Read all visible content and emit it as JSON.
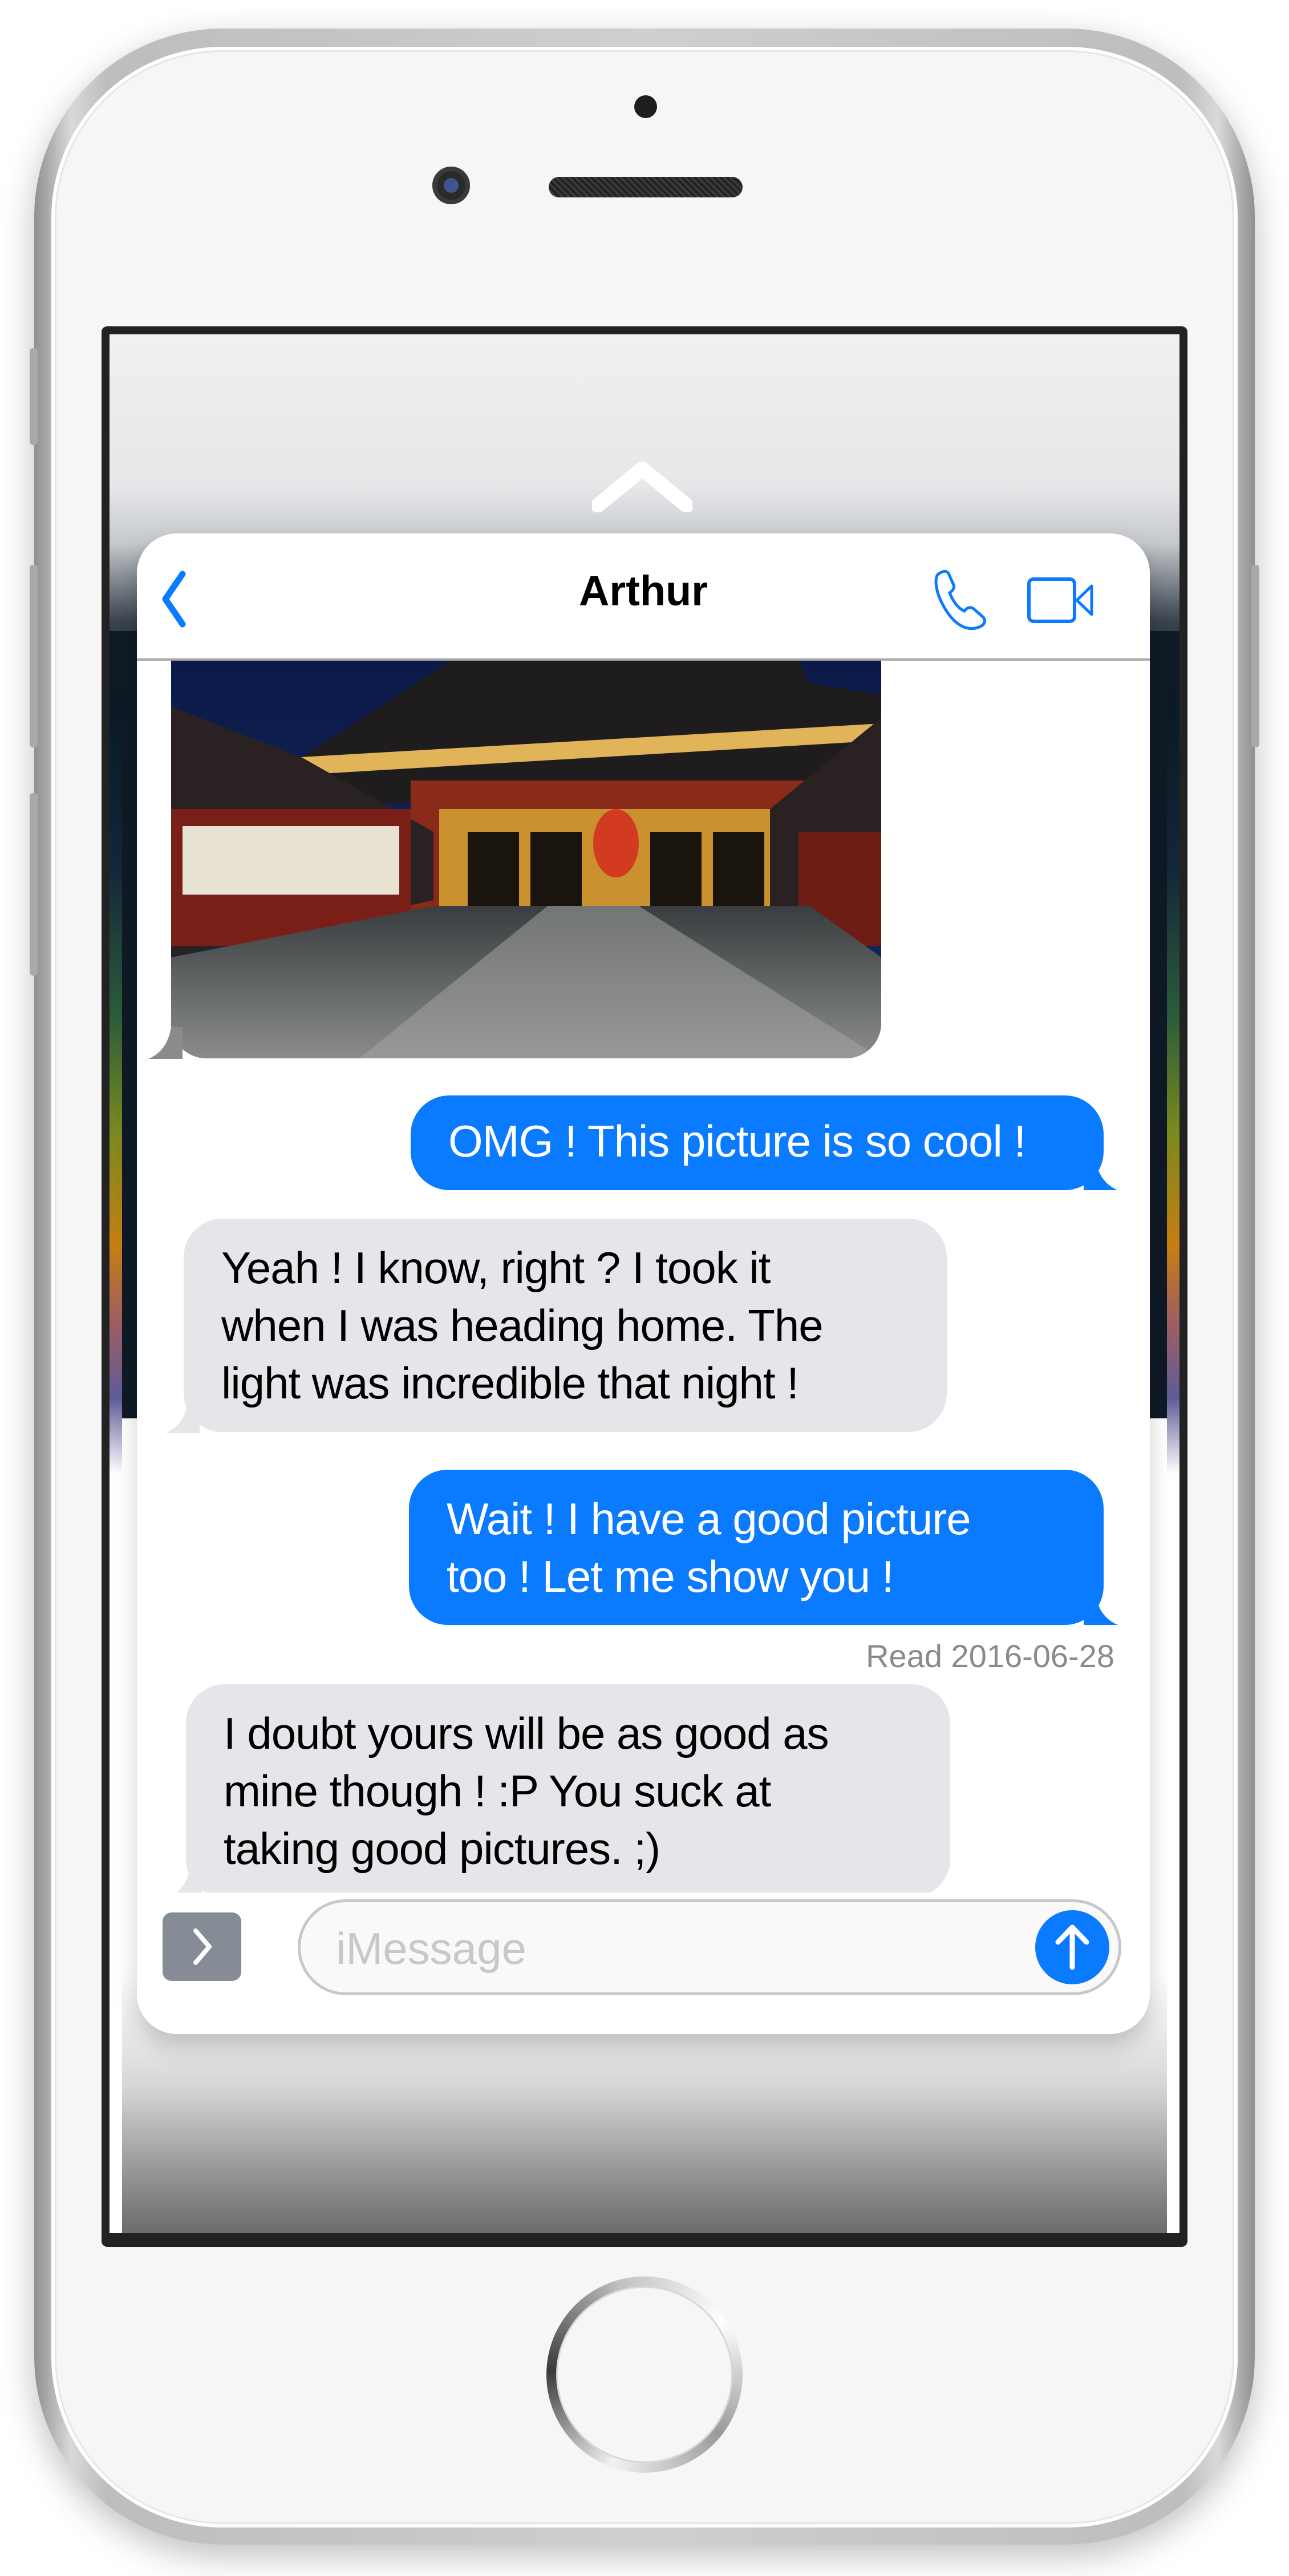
{
  "device": {
    "type": "iPhone",
    "home_button": "home-button",
    "colors": {
      "body": "#cfcfcf",
      "face": "#f6f6f6",
      "bezel": "#222222"
    }
  },
  "peek": {
    "handle_icon": "chevron-up-icon"
  },
  "conversation": {
    "header": {
      "back_icon": "chevron-left-icon",
      "title": "Arthur",
      "call_icon": "phone-icon",
      "video_icon": "video-camera-icon"
    },
    "messages": [
      {
        "type": "image",
        "direction": "incoming",
        "alt": "Temple at night photo"
      },
      {
        "type": "text",
        "direction": "outgoing",
        "text": "OMG ! This picture is so cool !"
      },
      {
        "type": "text",
        "direction": "incoming",
        "text": "Yeah ! I know, right ? I took it\nwhen I was heading home. The\nlight was incredible that night !"
      },
      {
        "type": "text",
        "direction": "outgoing",
        "text": "Wait ! I have a good picture\ntoo ! Let me show you !"
      },
      {
        "type": "text",
        "direction": "incoming",
        "text": "I doubt yours will be as good as\nmine though ! :P You suck at\ntaking good pictures. ;)"
      }
    ],
    "read_receipt": "Read 2016-06-28",
    "composer": {
      "expand_icon": "chevron-right-icon",
      "placeholder": "iMessage",
      "value": "",
      "send_icon": "arrow-up-icon"
    },
    "colors": {
      "accent": "#0a7aff",
      "incoming_bubble": "#e5e5ea",
      "outgoing_bubble": "#0a7aff",
      "read_text": "#8a8a8e"
    }
  }
}
